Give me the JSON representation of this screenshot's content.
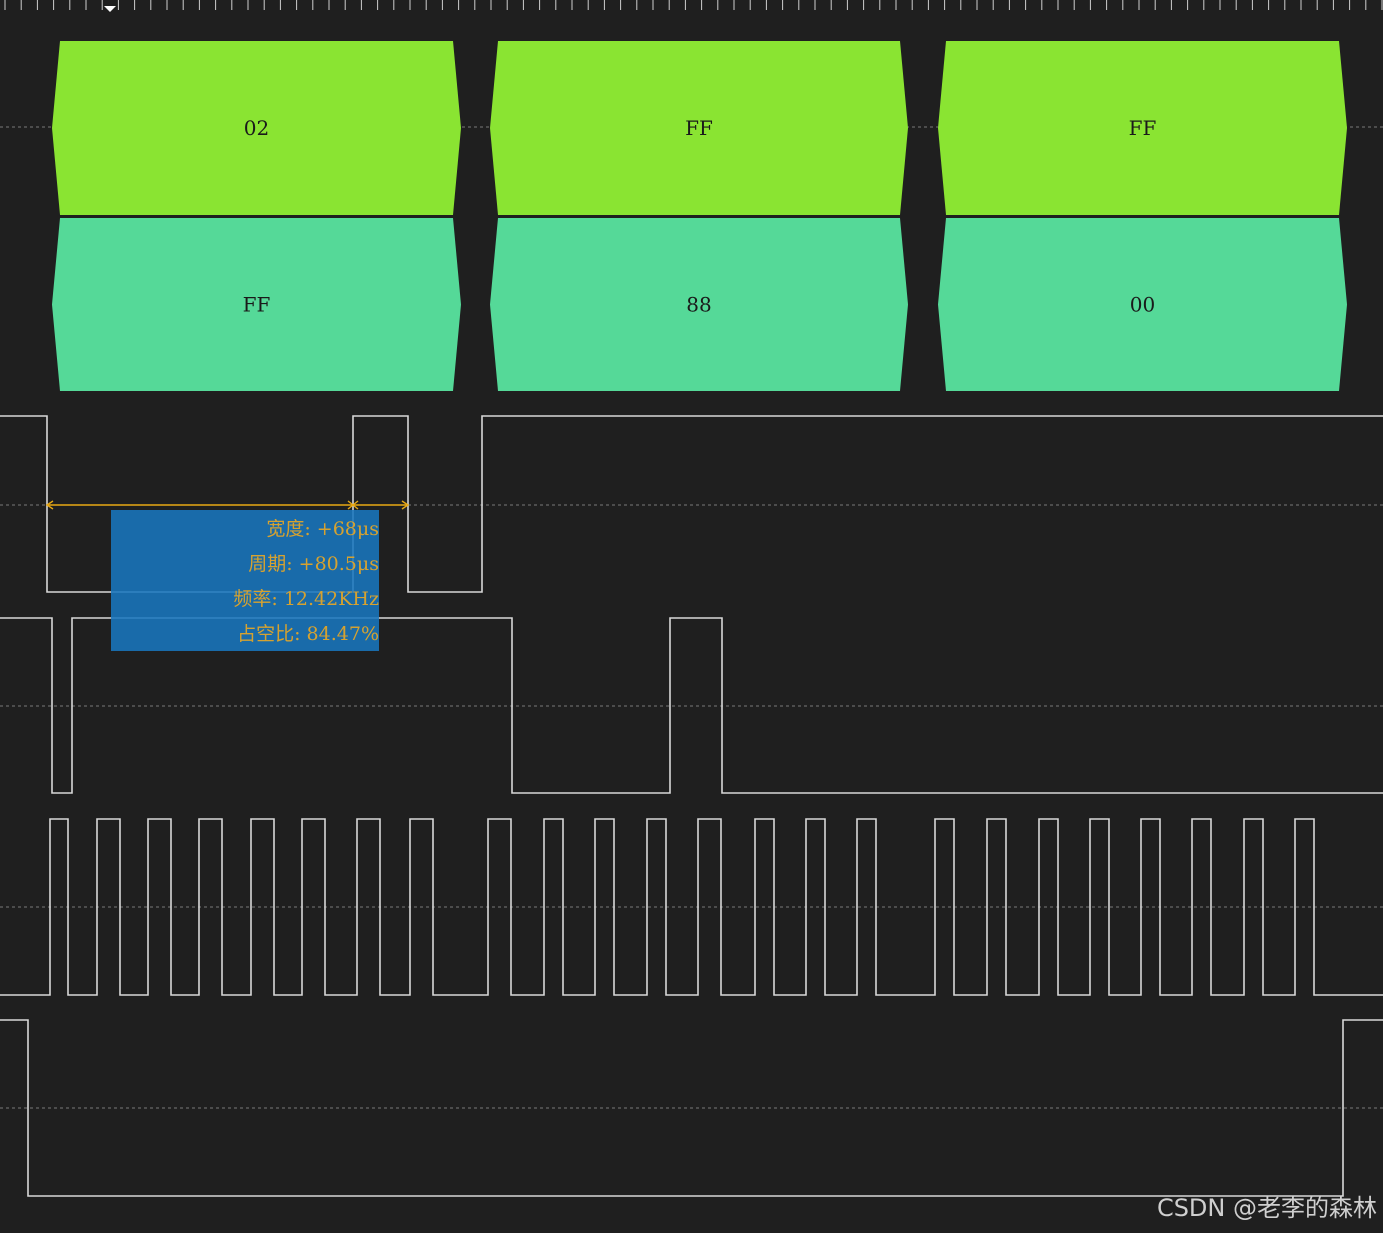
{
  "colors": {
    "background": "#1f1f1f",
    "decoder_row_1": "#8ae432",
    "decoder_row_2": "#55d998",
    "signal_line": "#d8d8d8",
    "grid_dash": "#7a7a7a",
    "cursor": "#e8a814",
    "measure_box": "#1976be",
    "measure_text": "#d6a230"
  },
  "decoder": {
    "row1": [
      "02",
      "FF",
      "FF"
    ],
    "row2": [
      "FF",
      "88",
      "00"
    ]
  },
  "measurement": {
    "width": "宽度: +68μs",
    "period": "周期: +80.5μs",
    "frequency": "频率: 12.42KHz",
    "duty": "占空比: 84.47%"
  },
  "watermark": "CSDN @老李的森林",
  "icons": {
    "time_marker": "triangle-down-icon"
  }
}
